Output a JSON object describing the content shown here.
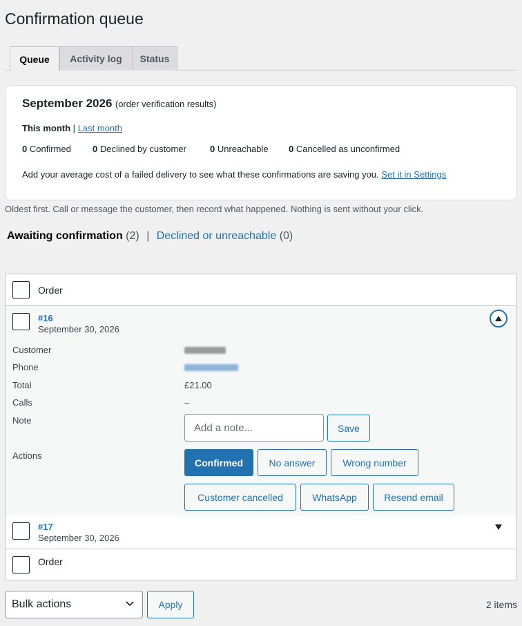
{
  "page": {
    "title": "Confirmation queue"
  },
  "tabs": [
    {
      "label": "Queue",
      "active": true
    },
    {
      "label": "Activity log",
      "active": false
    },
    {
      "label": "Status",
      "active": false
    }
  ],
  "summary": {
    "month": "September 2026",
    "subtitle": "(order verification results)",
    "this_month": "This month",
    "divider": "|",
    "last_month": "Last month",
    "stats": [
      {
        "count": "0",
        "label": "Confirmed"
      },
      {
        "count": "0",
        "label": "Declined by customer"
      },
      {
        "count": "0",
        "label": "Unreachable"
      },
      {
        "count": "0",
        "label": "Cancelled as unconfirmed"
      }
    ],
    "cost_text": "Add your average cost of a failed delivery to see what these confirmations are saving you.",
    "settings_link": "Set it in Settings"
  },
  "help_text": "Oldest first. Call or message the customer, then record what happened. Nothing is sent without your click.",
  "views": {
    "awaiting_label": "Awaiting confirmation",
    "awaiting_count": "(2)",
    "separator": "|",
    "declined_label": "Declined or unreachable",
    "declined_count": "(0)"
  },
  "table": {
    "column_header": "Order",
    "column_footer": "Order",
    "rows": [
      {
        "order": "#16",
        "date": "September 30, 2026",
        "expanded": true,
        "fields": {
          "customer_label": "Customer",
          "phone_label": "Phone",
          "total_label": "Total",
          "total_value": "£21.00",
          "calls_label": "Calls",
          "calls_value": "–",
          "note_label": "Note",
          "note_placeholder": "Add a note...",
          "save_label": "Save",
          "actions_label": "Actions"
        },
        "actions": {
          "confirmed": "Confirmed",
          "no_answer": "No answer",
          "wrong_number": "Wrong number",
          "customer_cancelled": "Customer cancelled",
          "whatsapp": "WhatsApp",
          "resend_email": "Resend email"
        }
      },
      {
        "order": "#17",
        "date": "September 30, 2026",
        "expanded": false
      }
    ]
  },
  "bulk": {
    "selected": "Bulk actions",
    "apply_label": "Apply"
  },
  "items_count": "2 items",
  "colors": {
    "accent": "#2271b1",
    "background": "#f0f0f1",
    "text": "#1d2327"
  }
}
